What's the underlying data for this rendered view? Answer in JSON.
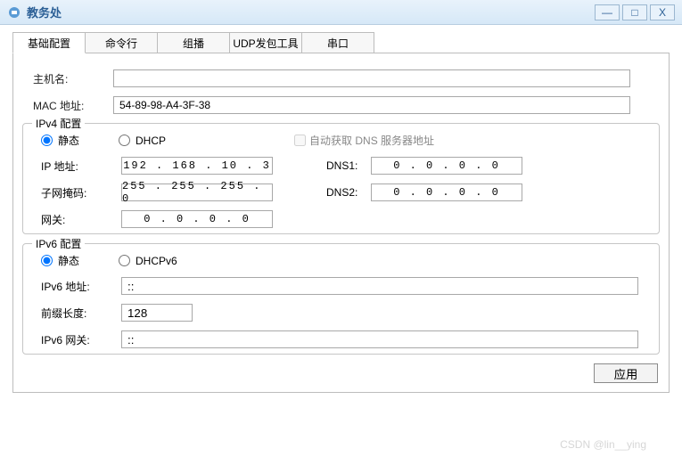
{
  "title": "教务处",
  "tabs": [
    "基础配置",
    "命令行",
    "组播",
    "UDP发包工具",
    "串口"
  ],
  "basic": {
    "hostLabel": "主机名:",
    "hostValue": "",
    "macLabel": "MAC 地址:",
    "macValue": "54-89-98-A4-3F-38"
  },
  "ipv4": {
    "legend": "IPv4 配置",
    "staticLabel": "静态",
    "dhcpLabel": "DHCP",
    "autoDnsLabel": "自动获取 DNS 服务器地址",
    "ipLabel": "IP 地址:",
    "ipValue": "192 . 168  .  10   .  3",
    "maskLabel": "子网掩码:",
    "maskValue": "255 . 255  . 255  .  0",
    "gwLabel": "网关:",
    "gwValue": "0   .  0   .  0   .  0",
    "dns1Label": "DNS1:",
    "dns1Value": "0   .  0   .  0   .  0",
    "dns2Label": "DNS2:",
    "dns2Value": "0   .  0   .  0   .  0"
  },
  "ipv6": {
    "legend": "IPv6 配置",
    "staticLabel": "静态",
    "dhcpLabel": "DHCPv6",
    "addrLabel": "IPv6 地址:",
    "addrValue": "::",
    "prefixLabel": "前缀长度:",
    "prefixValue": "128",
    "gwLabel": "IPv6 网关:",
    "gwValue": "::"
  },
  "applyLabel": "应用",
  "watermark": "CSDN @lin__ying"
}
